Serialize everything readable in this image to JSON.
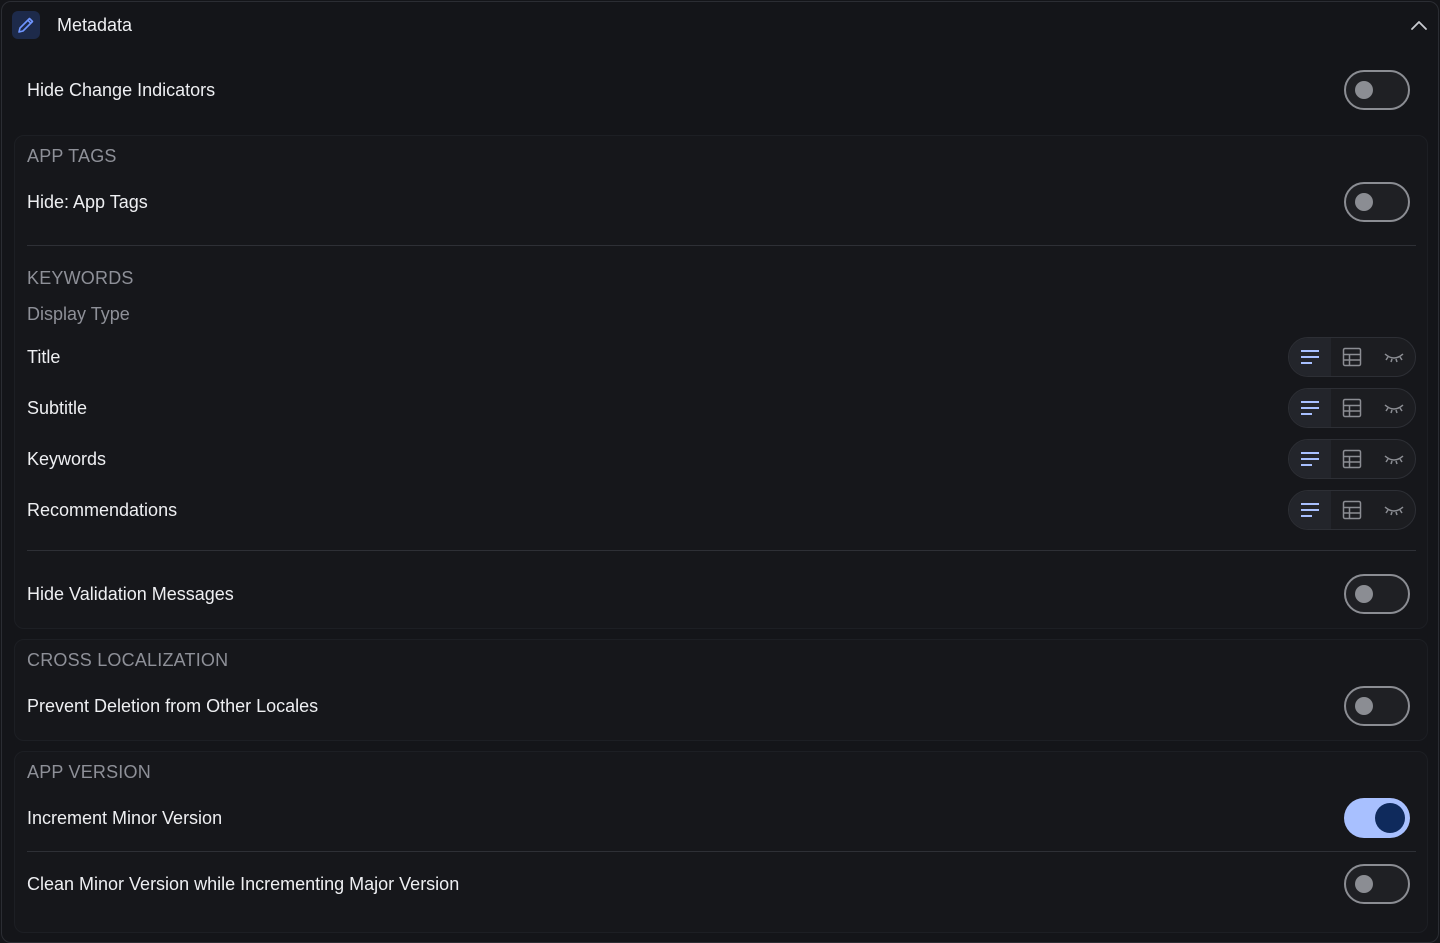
{
  "header": {
    "title": "Metadata"
  },
  "hide_change_indicators": {
    "label": "Hide Change Indicators",
    "enabled": false
  },
  "app_tags": {
    "section_title": "APP TAGS",
    "hide_app_tags": {
      "label": "Hide: App Tags",
      "enabled": false
    }
  },
  "keywords": {
    "section_title": "KEYWORDS",
    "display_type_label": "Display Type",
    "rows": [
      {
        "label": "Title",
        "selected": "list-view"
      },
      {
        "label": "Subtitle",
        "selected": "list-view"
      },
      {
        "label": "Keywords",
        "selected": "list-view"
      },
      {
        "label": "Recommendations",
        "selected": "list-view"
      }
    ],
    "options": [
      "list-view-icon",
      "table-view-icon",
      "hidden-eye-icon"
    ]
  },
  "hide_validation_messages": {
    "label": "Hide Validation Messages",
    "enabled": false
  },
  "cross_localization": {
    "section_title": "CROSS LOCALIZATION",
    "prevent_deletion": {
      "label": "Prevent Deletion from Other Locales",
      "enabled": false
    }
  },
  "app_version": {
    "section_title": "APP VERSION",
    "increment_minor": {
      "label": "Increment Minor Version",
      "enabled": true
    },
    "clean_minor": {
      "label": "Clean Minor Version while Incrementing Major Version",
      "enabled": false
    }
  },
  "colors": {
    "background": "#141519",
    "accent": "#a8c0ff",
    "accent_dark": "#0f2a5c",
    "muted_text": "#8e9098"
  }
}
